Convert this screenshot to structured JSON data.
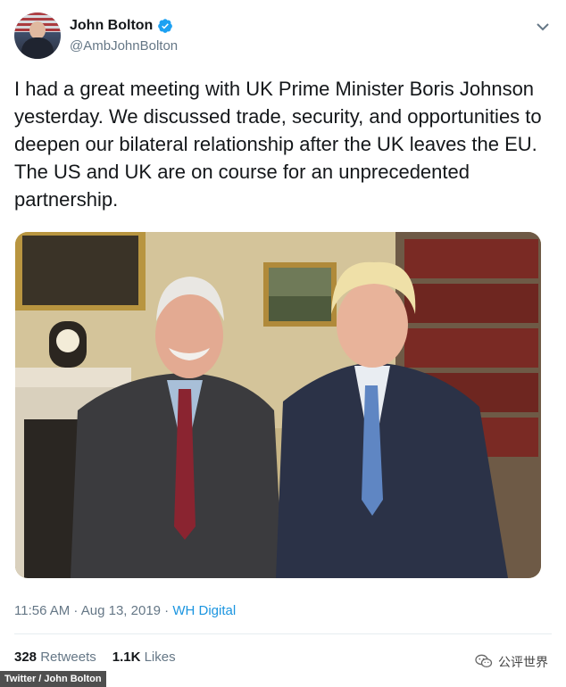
{
  "tweet": {
    "author": {
      "display_name": "John Bolton",
      "handle": "@AmbJohnBolton",
      "verified": true
    },
    "text": "I had a great meeting with UK Prime Minister Boris Johnson yesterday. We discussed trade, security, and opportunities to deepen our bilateral relationship after the UK leaves the EU. The US and UK are on course for an unprecedented partnership.",
    "timestamp": "11:56 AM · Aug 13, 2019 · ",
    "source": "WH Digital",
    "retweets_count": "328",
    "retweets_label": "Retweets",
    "likes_count": "1.1K",
    "likes_label": "Likes"
  },
  "credit": "Twitter / John Bolton",
  "watermark": {
    "text": "公评世界",
    "icon": "wechat-icon"
  },
  "colors": {
    "accent": "#1b95e0",
    "verified": "#1da1f2",
    "muted": "#657786"
  }
}
